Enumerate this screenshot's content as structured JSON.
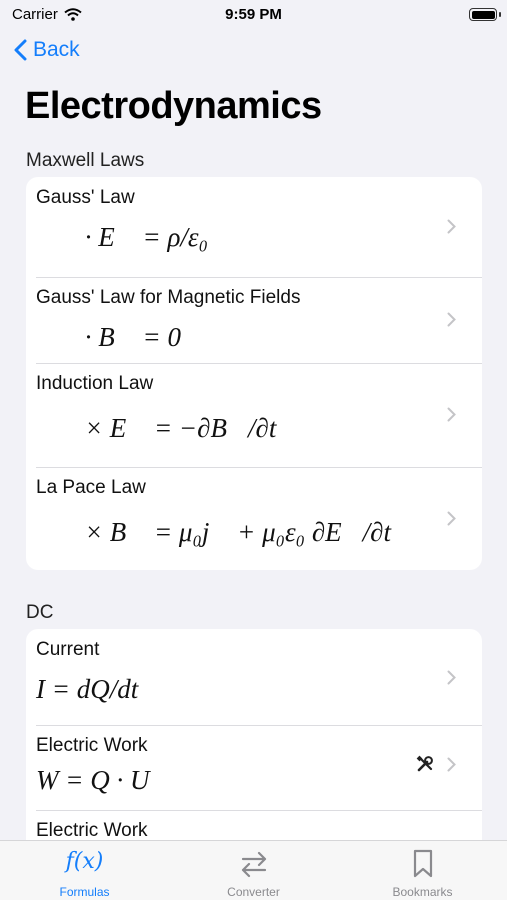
{
  "status_bar": {
    "carrier": "Carrier",
    "time": "9:59 PM"
  },
  "nav": {
    "back_label": "Back",
    "title": "Electrodynamics"
  },
  "sections": [
    {
      "header": "Maxwell Laws",
      "rows": [
        {
          "title": "Gauss' Law",
          "formula": "∇⃗ · E⃗ = ρ/ε₀"
        },
        {
          "title": "Gauss' Law for Magnetic Fields",
          "formula": "∇⃗ · B⃗ = 0"
        },
        {
          "title": "Induction Law",
          "formula": "∇⃗ × E⃗ = −∂B⃗/∂t"
        },
        {
          "title": "La Pace Law",
          "formula": "∇⃗ × B⃗ = μ₀j⃗ + μ₀ε₀ ∂E⃗/∂t"
        }
      ]
    },
    {
      "header": "DC",
      "rows": [
        {
          "title": "Current",
          "formula": "I = dQ/dt"
        },
        {
          "title": "Electric Work",
          "formula": "W = Q · U",
          "icon": "tools-icon"
        },
        {
          "title": "Electric Work"
        }
      ]
    }
  ],
  "tabs": [
    {
      "label": "Formulas",
      "icon": "fx-icon",
      "active": true
    },
    {
      "label": "Converter",
      "icon": "arrows-exchange-icon",
      "active": false
    },
    {
      "label": "Bookmarks",
      "icon": "bookmark-icon",
      "active": false
    }
  ],
  "colors": {
    "accent": "#147efb",
    "background": "#f2f2f7",
    "inactive_tab": "#8a8a8e"
  }
}
